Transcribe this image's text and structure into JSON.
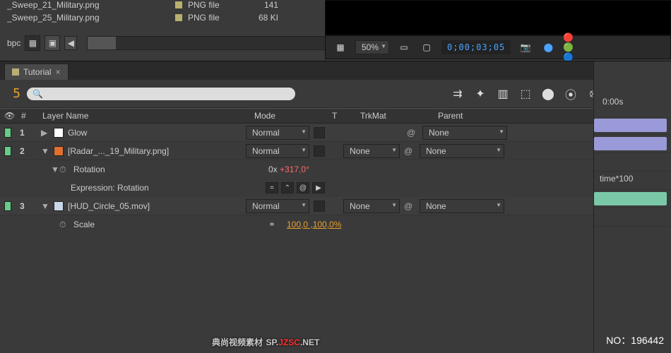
{
  "project": {
    "files": [
      {
        "name": "_Sweep_21_Military.png",
        "type": "PNG file",
        "size": "141"
      },
      {
        "name": "_Sweep_25_Military.png",
        "type": "PNG file",
        "size": "68 KI"
      }
    ],
    "bpc_label": "bpc"
  },
  "preview": {
    "zoom": "50%",
    "timecode": "0;00;03;05"
  },
  "timeline": {
    "tab": "Tutorial",
    "current_time_tail": "5",
    "ruler_start": "0:00s",
    "search_placeholder": "",
    "columns": {
      "num": "#",
      "name": "Layer Name",
      "mode": "Mode",
      "t": "T",
      "trk": "TrkMat",
      "parent": "Parent"
    },
    "none_label": "None",
    "normal_label": "Normal",
    "layers": [
      {
        "num": "1",
        "name": "Glow",
        "mode": "Normal",
        "trkmat": "",
        "parent": "None",
        "icon": "solid"
      },
      {
        "num": "2",
        "name": "[Radar_..._19_Military.png]",
        "mode": "Normal",
        "trkmat": "None",
        "parent": "None",
        "icon": "img",
        "props": {
          "rotation_label": "Rotation",
          "rotation_value_turns": "0x",
          "rotation_value_deg": "+317,0°",
          "expression_label": "Expression: Rotation",
          "expression_text": "time*100"
        }
      },
      {
        "num": "3",
        "name": "[HUD_Circle_05.mov]",
        "mode": "Normal",
        "trkmat": "None",
        "parent": "None",
        "icon": "mov",
        "props": {
          "scale_label": "Scale",
          "scale_value": "100,0 ,100,0%"
        }
      }
    ]
  },
  "watermark": {
    "text_cn": "典尚视频素材",
    "url_prefix": "SP.",
    "url_main": "JZSC",
    "url_suffix": ".NET",
    "no": "NO：196442"
  }
}
